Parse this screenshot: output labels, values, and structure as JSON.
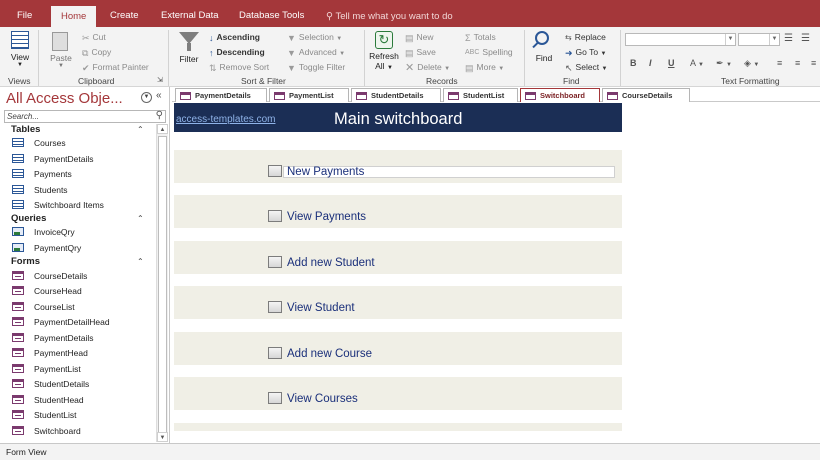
{
  "menu": {
    "tabs": [
      "File",
      "Home",
      "Create",
      "External Data",
      "Database Tools"
    ],
    "active_tab": "Home",
    "tell_me": "Tell me what you want to do"
  },
  "ribbon": {
    "views": {
      "view_label": "View",
      "group": "Views"
    },
    "clipboard": {
      "paste": "Paste",
      "cut": "Cut",
      "copy": "Copy",
      "format_painter": "Format Painter",
      "group": "Clipboard"
    },
    "sort_filter": {
      "filter": "Filter",
      "ascending": "Ascending",
      "descending": "Descending",
      "remove_sort": "Remove Sort",
      "selection": "Selection",
      "advanced": "Advanced",
      "toggle_filter": "Toggle Filter",
      "group": "Sort & Filter"
    },
    "records": {
      "refresh": "Refresh",
      "refresh_all": "All",
      "new": "New",
      "save": "Save",
      "delete": "Delete",
      "totals": "Totals",
      "spelling": "Spelling",
      "more": "More",
      "group": "Records"
    },
    "find": {
      "find": "Find",
      "replace": "Replace",
      "goto": "Go To",
      "select": "Select",
      "group": "Find"
    },
    "text_formatting": {
      "bold": "B",
      "italic": "I",
      "underline": "U",
      "group": "Text Formatting"
    }
  },
  "nav": {
    "title": "All Access Obje...",
    "search_placeholder": "Search...",
    "sections": {
      "tables": "Tables",
      "queries": "Queries",
      "forms": "Forms"
    },
    "tables": [
      "Courses",
      "PaymentDetails",
      "Payments",
      "Students",
      "Switchboard Items"
    ],
    "queries": [
      "InvoiceQry",
      "PaymentQry"
    ],
    "forms": [
      "CourseDetails",
      "CourseHead",
      "CourseList",
      "PaymentDetailHead",
      "PaymentDetails",
      "PaymentHead",
      "PaymentList",
      "StudentDetails",
      "StudentHead",
      "StudentList",
      "Switchboard"
    ]
  },
  "doc_tabs": [
    "PaymentDetails",
    "PaymentList",
    "StudentDetails",
    "StudentList",
    "Switchboard",
    "CourseDetails"
  ],
  "active_doc_tab": "Switchboard",
  "form": {
    "site_link": "access-templates.com",
    "title": "Main switchboard",
    "items": [
      "New Payments",
      "View Payments",
      "Add new Student",
      "View Student",
      "Add new Course",
      "View Courses"
    ]
  },
  "status": {
    "text": "Form View"
  },
  "colors": {
    "accent": "#a4373a",
    "header": "#1b2e55",
    "band": "#f0efe6",
    "label": "#1a2f7a"
  }
}
